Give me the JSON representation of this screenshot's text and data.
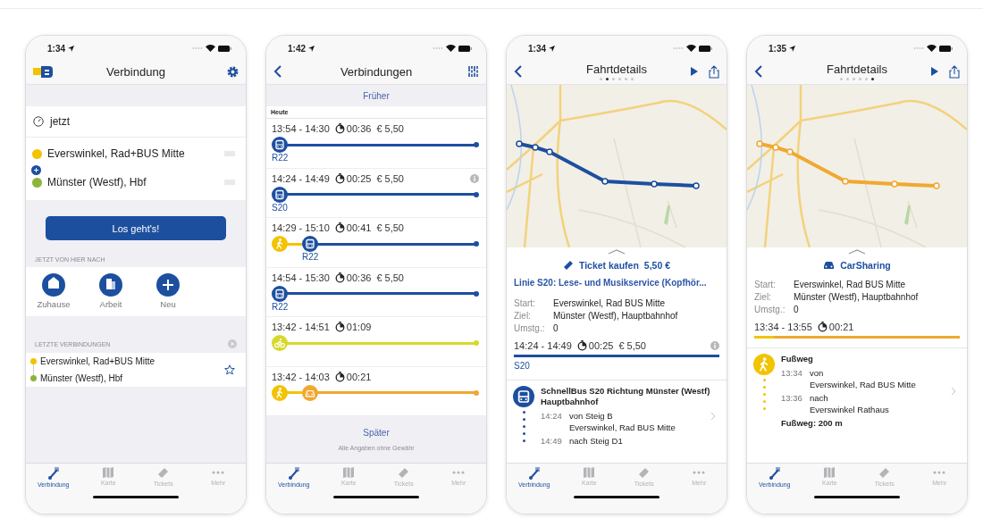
{
  "phones": [
    {
      "kind": "planner",
      "status_time": "1:34",
      "title": "Verbindung",
      "when": "jetzt",
      "stops": [
        {
          "name": "Everswinkel, Rad+BUS Mitte",
          "color": "#f2c300"
        },
        {
          "name": "Münster (Westf), Hbf",
          "color": "#8cb53a"
        }
      ],
      "go_button": "Los geht's!",
      "shortcuts_header": "JETZT VON HIER NACH",
      "shortcuts": [
        {
          "label": "Zuhause",
          "kind": "home"
        },
        {
          "label": "Arbeit",
          "kind": "work"
        },
        {
          "label": "Neu",
          "kind": "add"
        }
      ],
      "recent_header": "LETZTE VERBINDUNGEN",
      "recent": [
        {
          "stops": [
            {
              "name": "Everswinkel, Rad+BUS Mitte",
              "color": "#f2c300"
            },
            {
              "name": "Münster (Westf), Hbf",
              "color": "#8cb53a"
            }
          ],
          "favorite": false
        }
      ],
      "tabs": [
        {
          "label": "Verbindung",
          "selected": true
        },
        {
          "label": "Karte",
          "selected": false
        },
        {
          "label": "Tickets",
          "selected": false
        },
        {
          "label": "Mehr",
          "selected": false
        }
      ]
    },
    {
      "kind": "results",
      "status_time": "1:42",
      "title": "Verbindungen",
      "earlier": "Früher",
      "day": "Heute",
      "connections": [
        {
          "time": "13:54 - 14:30",
          "duration": "00:36",
          "price": "€ 5,50",
          "info": false,
          "legs": [
            {
              "kind": "bus",
              "color": "#1d4f9f",
              "line": "R22"
            }
          ]
        },
        {
          "time": "14:24 - 14:49",
          "duration": "00:25",
          "price": "€ 5,50",
          "info": true,
          "legs": [
            {
              "kind": "bus",
              "color": "#1d4f9f",
              "line": "S20"
            }
          ]
        },
        {
          "time": "14:29 - 15:10",
          "duration": "00:41",
          "price": "€ 5,50",
          "info": false,
          "legs": [
            {
              "kind": "walk",
              "color": "#f2c300"
            },
            {
              "kind": "bus",
              "color": "#1d4f9f",
              "line": "R22"
            }
          ]
        },
        {
          "time": "14:54 - 15:30",
          "duration": "00:36",
          "price": "€ 5,50",
          "info": false,
          "legs": [
            {
              "kind": "bus",
              "color": "#1d4f9f",
              "line": "R22"
            }
          ]
        },
        {
          "time": "13:42 - 14:51",
          "duration": "01:09",
          "info": false,
          "legs": [
            {
              "kind": "bike",
              "color": "#d6d92a"
            }
          ]
        },
        {
          "time": "13:42 - 14:03",
          "duration": "00:21",
          "info": false,
          "legs": [
            {
              "kind": "walk",
              "color": "#f2c300"
            },
            {
              "kind": "car",
              "color": "#f0a830"
            }
          ]
        }
      ],
      "later": "Später",
      "disclaimer": "Alle Angaben ohne Gewähr",
      "tabs": [
        {
          "label": "Verbindung",
          "selected": true
        },
        {
          "label": "Karte",
          "selected": false
        },
        {
          "label": "Tickets",
          "selected": false
        },
        {
          "label": "Mehr",
          "selected": false
        }
      ]
    },
    {
      "kind": "details",
      "status_time": "1:34",
      "title": "Fahrtdetails",
      "pages": [
        {
          "selected": false
        },
        {
          "selected": true
        },
        {
          "selected": false
        },
        {
          "selected": false
        },
        {
          "selected": false
        },
        {
          "selected": false
        }
      ],
      "action": {
        "kind": "ticket",
        "label": "Ticket kaufen",
        "price": "5,50 €"
      },
      "notice": "Linie S20: Lese- und  Musikservice (Kopfhör...",
      "info_rows": [
        {
          "key": "Start:",
          "value": "Everswinkel, Rad BUS Mitte"
        },
        {
          "key": "Ziel:",
          "value": "Münster (Westf), Hauptbahnhof"
        },
        {
          "key": "Umstg.:",
          "value": "0"
        }
      ],
      "summary": {
        "time": "14:24 - 14:49",
        "duration": "00:25",
        "price": "€ 5,50",
        "info": true,
        "legs": [
          {
            "kind": "bus",
            "color": "#1d4f9f",
            "line": "S20"
          }
        ]
      },
      "leg": {
        "kind": "bus",
        "color": "#1d4f9f",
        "title": "SchnellBus S20 Richtung Münster (Westf)  Hauptbahnhof",
        "stops": [
          {
            "time": "14:24",
            "text": "von Steig B",
            "place": "Everswinkel, Rad BUS Mitte"
          },
          {
            "time": "14:49",
            "text": "nach Steig D1"
          }
        ]
      },
      "tabs": [
        {
          "label": "Verbindung",
          "selected": true
        },
        {
          "label": "Karte",
          "selected": false
        },
        {
          "label": "Tickets",
          "selected": false
        },
        {
          "label": "Mehr",
          "selected": false
        }
      ]
    },
    {
      "kind": "details",
      "status_time": "1:35",
      "title": "Fahrtdetails",
      "pages": [
        {
          "selected": false
        },
        {
          "selected": false
        },
        {
          "selected": false
        },
        {
          "selected": false
        },
        {
          "selected": false
        },
        {
          "selected": true
        }
      ],
      "action": {
        "kind": "car",
        "label": "CarSharing"
      },
      "info_rows": [
        {
          "key": "Start:",
          "value": "Everswinkel, Rad BUS Mitte"
        },
        {
          "key": "Ziel:",
          "value": "Münster (Westf), Hauptbahnhof"
        },
        {
          "key": "Umstg.:",
          "value": "0"
        }
      ],
      "summary": {
        "time": "13:34 - 13:55",
        "duration": "00:21",
        "info": false,
        "legs": [
          {
            "kind": "walk",
            "color": "#f2c300"
          },
          {
            "kind": "car",
            "color": "#f0a830"
          }
        ]
      },
      "leg": {
        "kind": "walk",
        "color": "#f2c300",
        "title": "Fußweg",
        "stops": [
          {
            "time": "13:34",
            "text": "von",
            "place": "Everswinkel, Rad BUS Mitte"
          },
          {
            "time": "13:36",
            "text": "nach",
            "place": "Everswinkel Rathaus"
          }
        ],
        "note": "Fußweg: 200 m"
      },
      "tabs": [
        {
          "label": "Verbindung",
          "selected": true
        },
        {
          "label": "Karte",
          "selected": false
        },
        {
          "label": "Tickets",
          "selected": false
        },
        {
          "label": "Mehr",
          "selected": false
        }
      ]
    }
  ]
}
